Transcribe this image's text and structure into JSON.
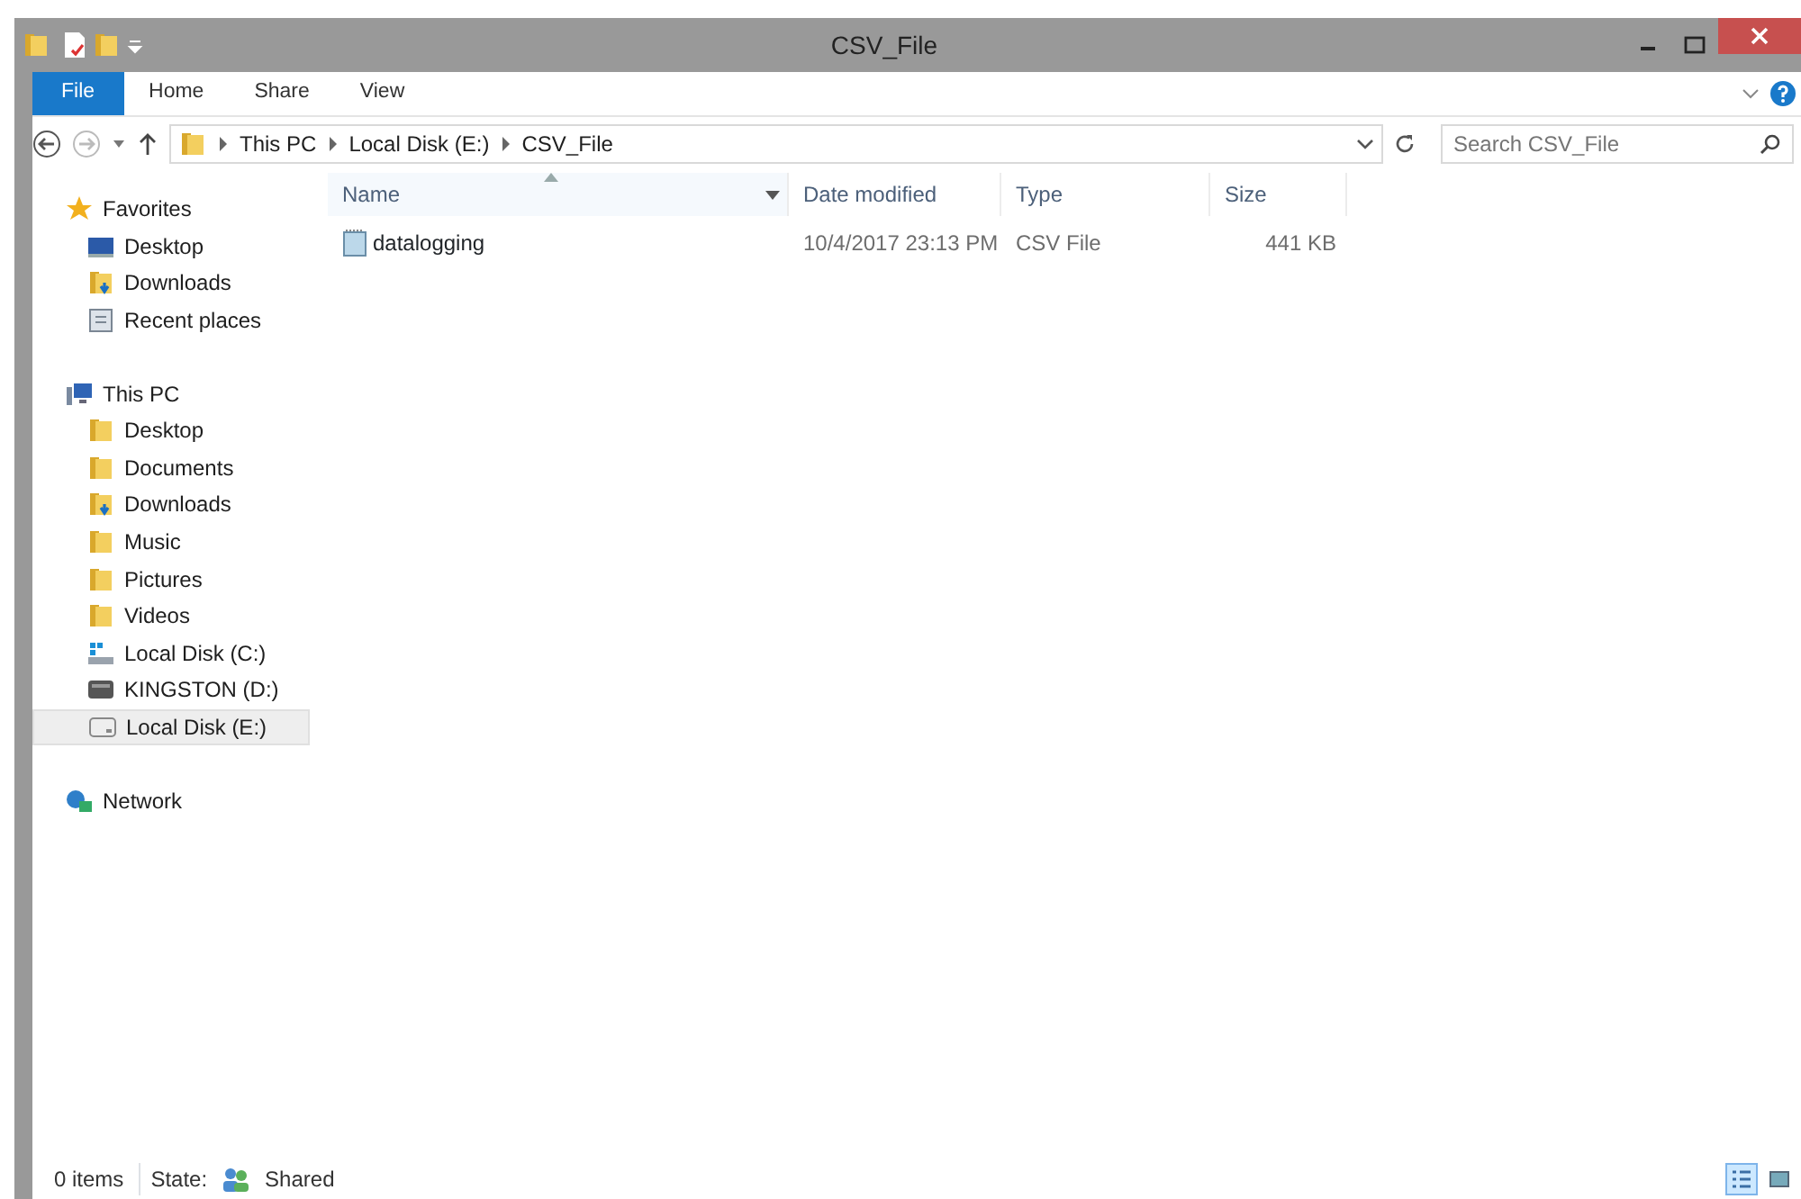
{
  "window": {
    "title": "CSV_File"
  },
  "ribbon_tabs": [
    {
      "label": "File",
      "kind": "file"
    },
    {
      "label": "Home",
      "kind": "tab"
    },
    {
      "label": "Share",
      "kind": "tab"
    },
    {
      "label": "View",
      "kind": "tab"
    }
  ],
  "address_bar": {
    "path": [
      "This PC",
      "Local Disk (E:)",
      "CSV_File"
    ]
  },
  "search": {
    "placeholder": "Search CSV_File"
  },
  "navigation": [
    {
      "label": "Favorites",
      "kind": "star",
      "selected": false,
      "children": [
        {
          "label": "Desktop",
          "kind": "monitor",
          "selected": false
        },
        {
          "label": "Downloads",
          "kind": "downloads",
          "selected": false
        },
        {
          "label": "Recent places",
          "kind": "recent",
          "selected": false
        }
      ]
    },
    {
      "label": "This PC",
      "kind": "computer",
      "selected": false,
      "children": [
        {
          "label": "Desktop",
          "kind": "folder",
          "selected": false
        },
        {
          "label": "Documents",
          "kind": "folder",
          "selected": false
        },
        {
          "label": "Downloads",
          "kind": "downloads",
          "selected": false
        },
        {
          "label": "Music",
          "kind": "folder",
          "selected": false
        },
        {
          "label": "Pictures",
          "kind": "folder",
          "selected": false
        },
        {
          "label": "Videos",
          "kind": "folder",
          "selected": false
        },
        {
          "label": "Local Disk (C:)",
          "kind": "system-drive",
          "selected": false
        },
        {
          "label": "KINGSTON (D:)",
          "kind": "usb-drive",
          "selected": false
        },
        {
          "label": "Local Disk (E:)",
          "kind": "drive",
          "selected": true
        }
      ]
    },
    {
      "label": "Network",
      "kind": "network",
      "selected": false
    }
  ],
  "file_list": {
    "columns": [
      {
        "label": "Name",
        "sorted": true
      },
      {
        "label": "Date modified",
        "sorted": false
      },
      {
        "label": "Type",
        "sorted": false
      },
      {
        "label": "Size",
        "sorted": false
      }
    ],
    "rows": [
      {
        "name": "datalogging",
        "date_modified": "10/4/2017 23:13 PM",
        "type": "CSV File",
        "size": "441 KB"
      }
    ]
  },
  "status_bar": {
    "items": "0 items",
    "state_label": "State:",
    "state": "Shared",
    "views": [
      {
        "kind": "details",
        "selected": true
      },
      {
        "kind": "large-icons",
        "selected": false
      }
    ]
  }
}
